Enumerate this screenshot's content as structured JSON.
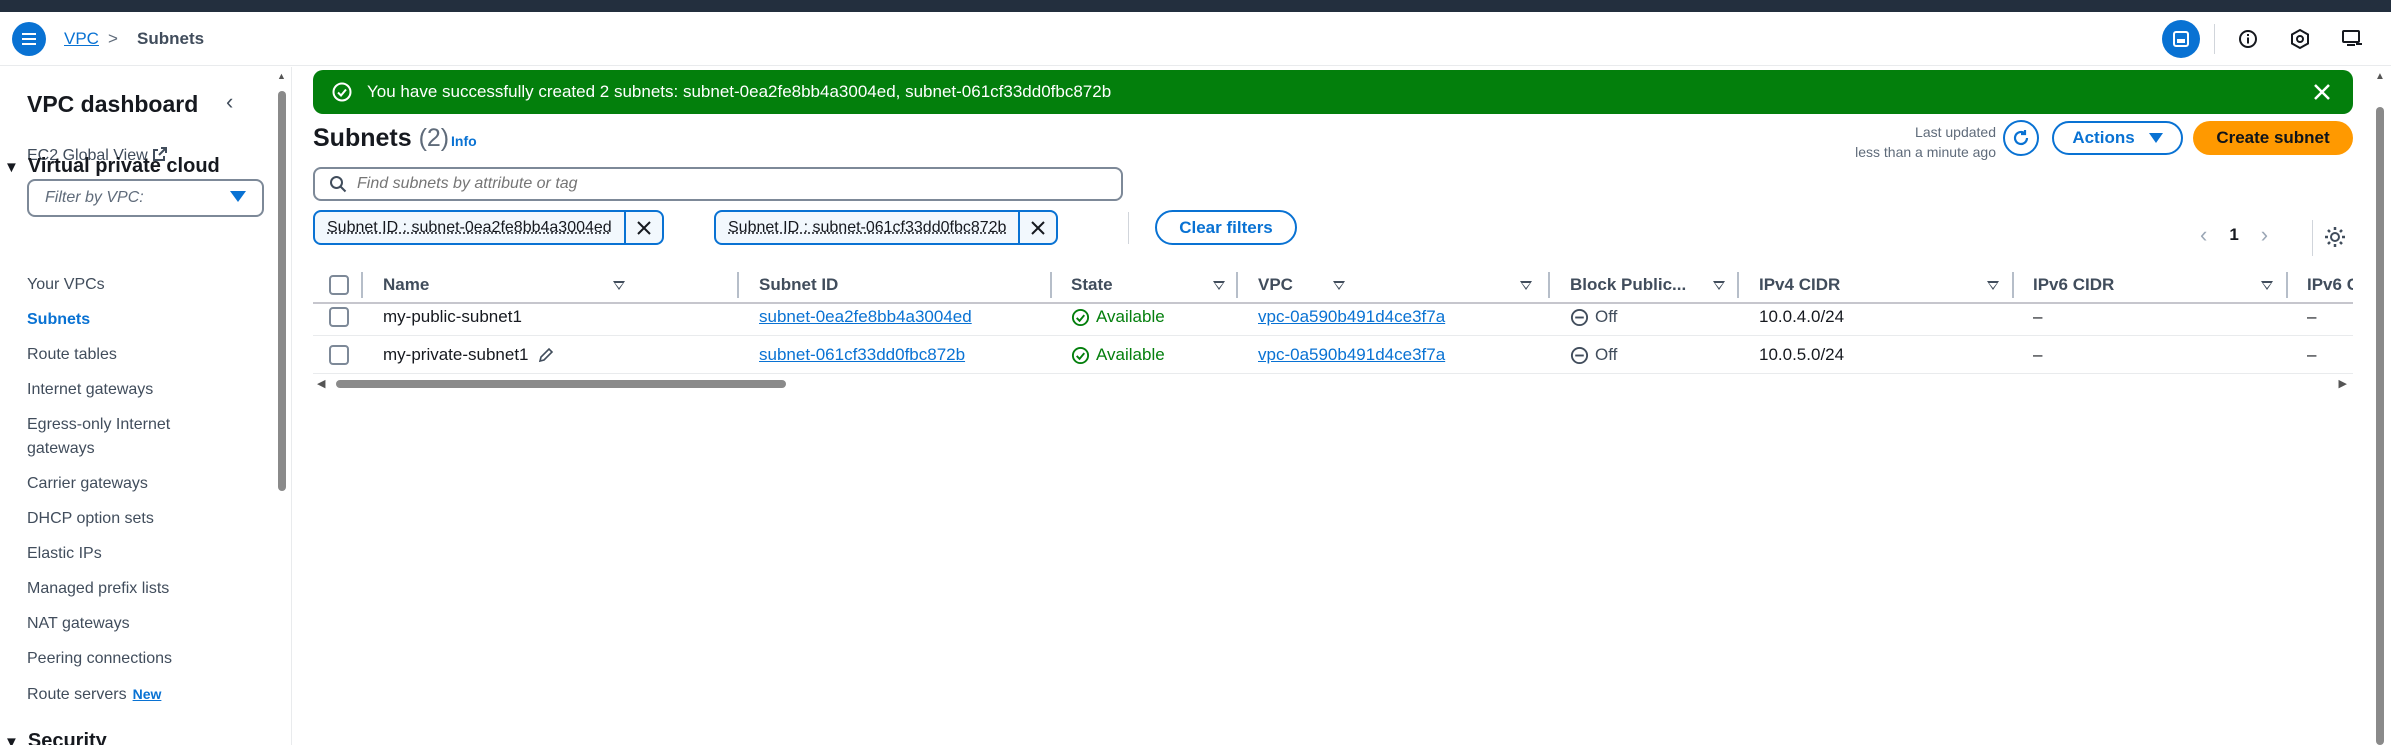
{
  "breadcrumb": {
    "root": "VPC",
    "separator": ">",
    "current": "Subnets"
  },
  "sidenav": {
    "title": "VPC dashboard",
    "ec2_global_view": "EC2 Global View",
    "filter_placeholder": "Filter by VPC:",
    "section_vpc": "Virtual private cloud",
    "items": [
      {
        "label": "Your VPCs"
      },
      {
        "label": "Subnets"
      },
      {
        "label": "Route tables"
      },
      {
        "label": "Internet gateways"
      },
      {
        "label": "Egress-only Internet"
      },
      {
        "label": "gateways"
      },
      {
        "label": "Carrier gateways"
      },
      {
        "label": "DHCP option sets"
      },
      {
        "label": "Elastic IPs"
      },
      {
        "label": "Managed prefix lists"
      },
      {
        "label": "NAT gateways"
      },
      {
        "label": "Peering connections"
      },
      {
        "label": "Route servers"
      }
    ],
    "new_badge": "New",
    "section_security": "Security",
    "active_item": "Subnets"
  },
  "flash": {
    "message": "You have successfully created 2 subnets: subnet-0ea2fe8bb4a3004ed, subnet-061cf33dd0fbc872b"
  },
  "header": {
    "title": "Subnets",
    "count": "(2)",
    "info": "Info",
    "last_updated_label": "Last updated",
    "last_updated_value": "less than a minute ago",
    "actions": "Actions",
    "create": "Create subnet"
  },
  "search": {
    "placeholder": "Find subnets by attribute or tag"
  },
  "filters": {
    "tokens": [
      {
        "label": "Subnet ID : subnet-0ea2fe8bb4a3004ed"
      },
      {
        "label": "Subnet ID : subnet-061cf33dd0fbc872b"
      }
    ],
    "clear": "Clear filters"
  },
  "pagination": {
    "prev": "<",
    "page": "1",
    "next": ">"
  },
  "table": {
    "columns": [
      "Name",
      "Subnet ID",
      "State",
      "VPC",
      "Block Public...",
      "IPv4 CIDR",
      "IPv6 CIDR",
      "IPv6 C"
    ],
    "rows": [
      {
        "name": "my-public-subnet1",
        "subnet_id": "subnet-0ea2fe8bb4a3004ed",
        "state": "Available",
        "vpc": "vpc-0a590b491d4ce3f7a",
        "block_public": "Off",
        "ipv4": "10.0.4.0/24",
        "ipv6": "–",
        "ipv6c": "–"
      },
      {
        "name": "my-private-subnet1",
        "subnet_id": "subnet-061cf33dd0fbc872b",
        "state": "Available",
        "vpc": "vpc-0a590b491d4ce3f7a",
        "block_public": "Off",
        "ipv4": "10.0.5.0/24",
        "ipv6": "–",
        "ipv6c": "–"
      }
    ]
  },
  "colors": {
    "primary": "#0972d3",
    "success": "#037f0c",
    "create": "#ff9900",
    "topbar": "#232f3e"
  }
}
